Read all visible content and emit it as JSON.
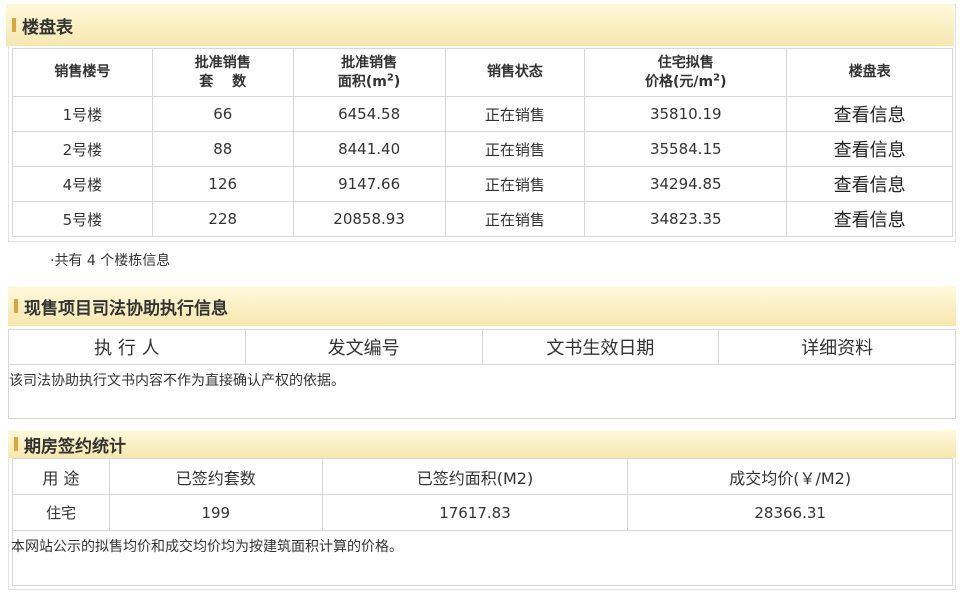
{
  "section1": {
    "title": "楼盘表",
    "headers": {
      "building": "销售楼号",
      "units_line1": "批准销售",
      "units_line2": "套　 数",
      "area_line1": "批准销售",
      "area_line2": "面积(m",
      "area_sup": "2",
      "area_close": ")",
      "status": "销售状态",
      "price_line1": "住宅拟售",
      "price_line2": "价格(元/m",
      "price_sup": "2",
      "price_close": ")",
      "table": "楼盘表"
    },
    "rows": [
      {
        "building": "1号楼",
        "units": "66",
        "area": "6454.58",
        "status": "正在销售",
        "price": "35810.19",
        "link": "查看信息"
      },
      {
        "building": "2号楼",
        "units": "88",
        "area": "8441.40",
        "status": "正在销售",
        "price": "35584.15",
        "link": "查看信息"
      },
      {
        "building": "4号楼",
        "units": "126",
        "area": "9147.66",
        "status": "正在销售",
        "price": "34294.85",
        "link": "查看信息"
      },
      {
        "building": "5号楼",
        "units": "228",
        "area": "20858.93",
        "status": "正在销售",
        "price": "34823.35",
        "link": "查看信息"
      }
    ],
    "count_text": "·共有 4 个楼栋信息"
  },
  "section2": {
    "title": "现售项目司法协助执行信息",
    "headers": [
      "执 行 人",
      "发文编号",
      "文书生效日期",
      "详细资料"
    ],
    "note": "该司法协助执行文书内容不作为直接确认产权的依据。"
  },
  "section3": {
    "title": "期房签约统计",
    "headers": [
      "用 途",
      "已签约套数",
      "已签约面积(M2)",
      "成交均价(￥/M2)"
    ],
    "row": {
      "use": "住宅",
      "units": "199",
      "area": "17617.83",
      "avg_price": "28366.31"
    },
    "note": "本网站公示的拟售均价和成交均价均为按建筑面积计算的价格。"
  }
}
